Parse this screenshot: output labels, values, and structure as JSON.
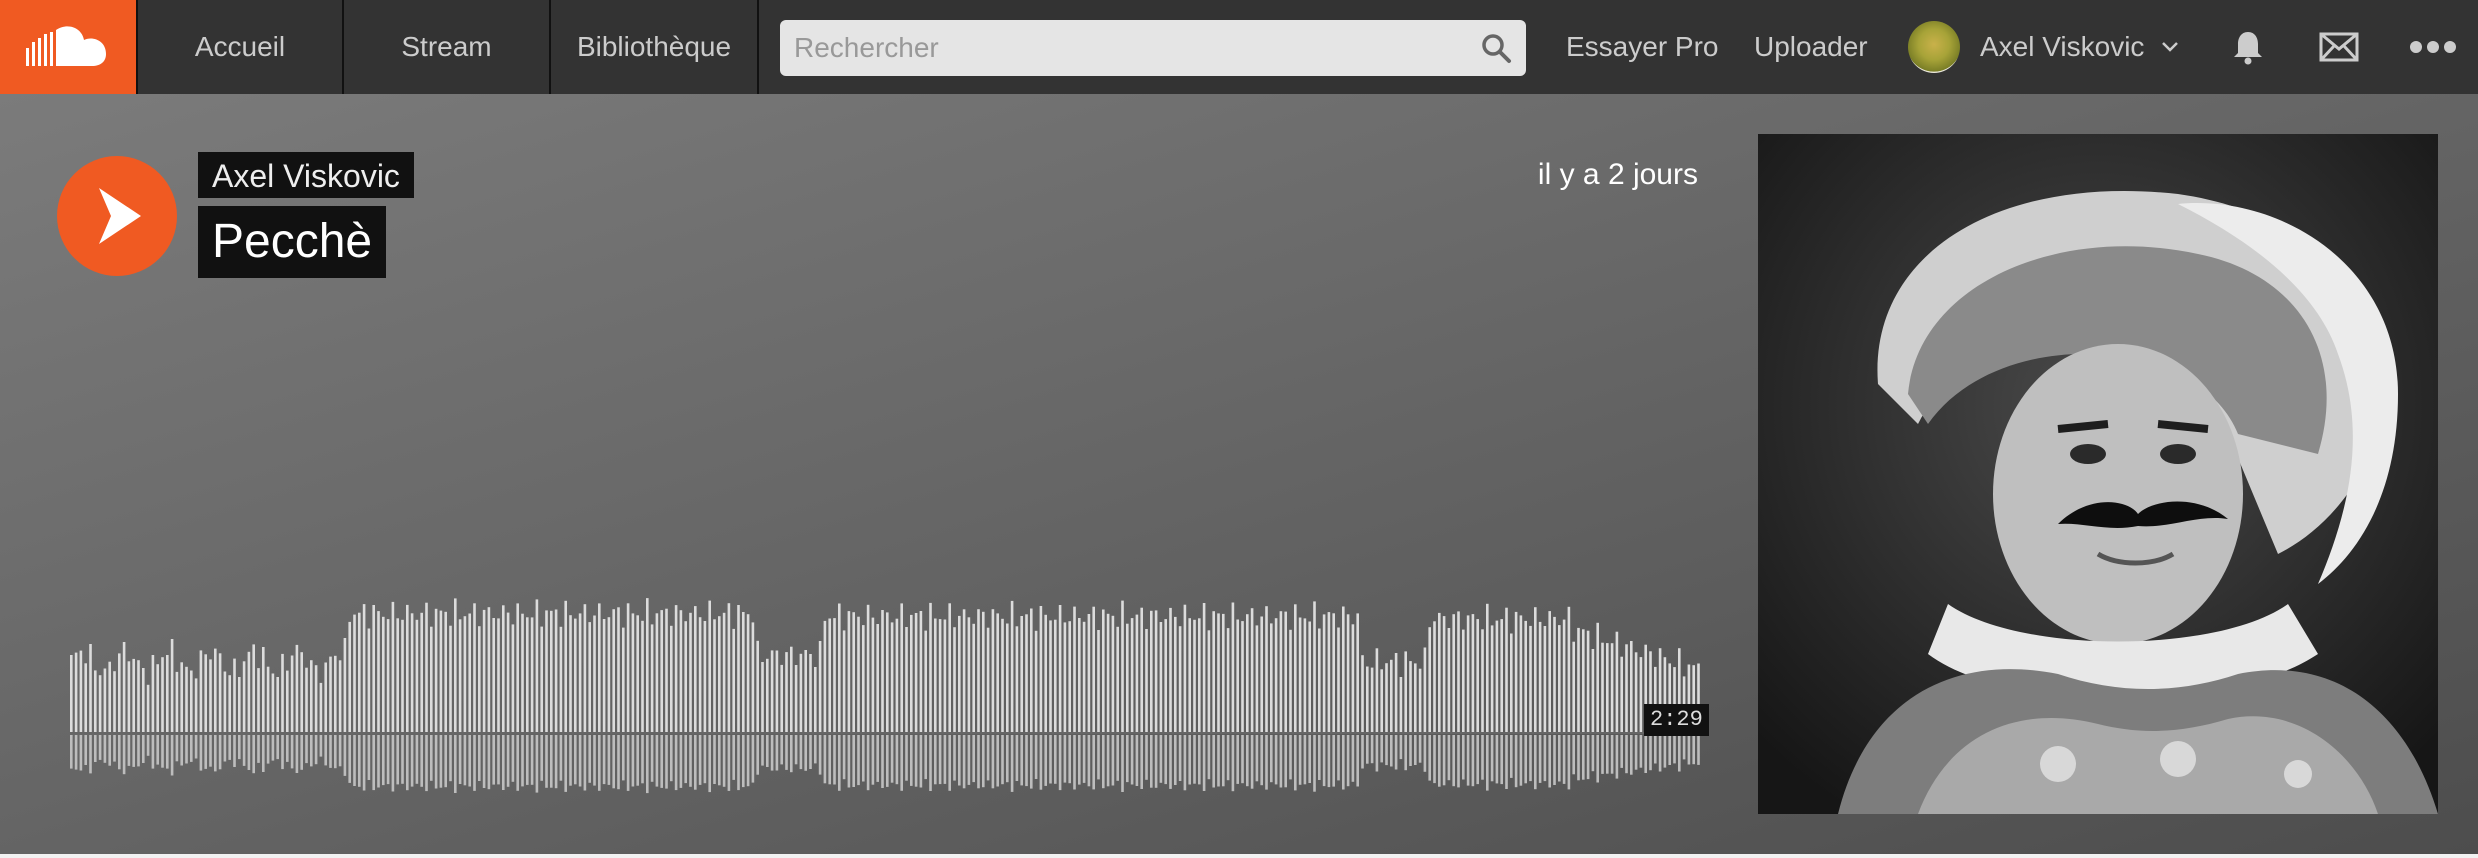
{
  "nav": {
    "tabs": [
      {
        "label": "Accueil"
      },
      {
        "label": "Stream"
      },
      {
        "label": "Bibliothèque"
      }
    ],
    "search": {
      "placeholder": "Rechercher"
    },
    "try_pro": "Essayer Pro",
    "upload": "Uploader",
    "user": {
      "name": "Axel Viskovic"
    },
    "icons": {
      "logo": "soundcloud-logo-icon",
      "search": "search-icon",
      "chevron": "chevron-down-icon",
      "bell": "bell-icon",
      "mail": "mail-icon",
      "more": "more-dots-icon"
    }
  },
  "track": {
    "artist": "Axel Viskovic",
    "title": "Pecchè",
    "posted": "il y a 2 jours",
    "duration": "2:29",
    "play_icon": "play-icon",
    "cover_icon": "cover-art-portrait-icon"
  },
  "colors": {
    "brand": "#f05a22",
    "topbar": "#333333",
    "waveform": "#dcdcdc"
  }
}
